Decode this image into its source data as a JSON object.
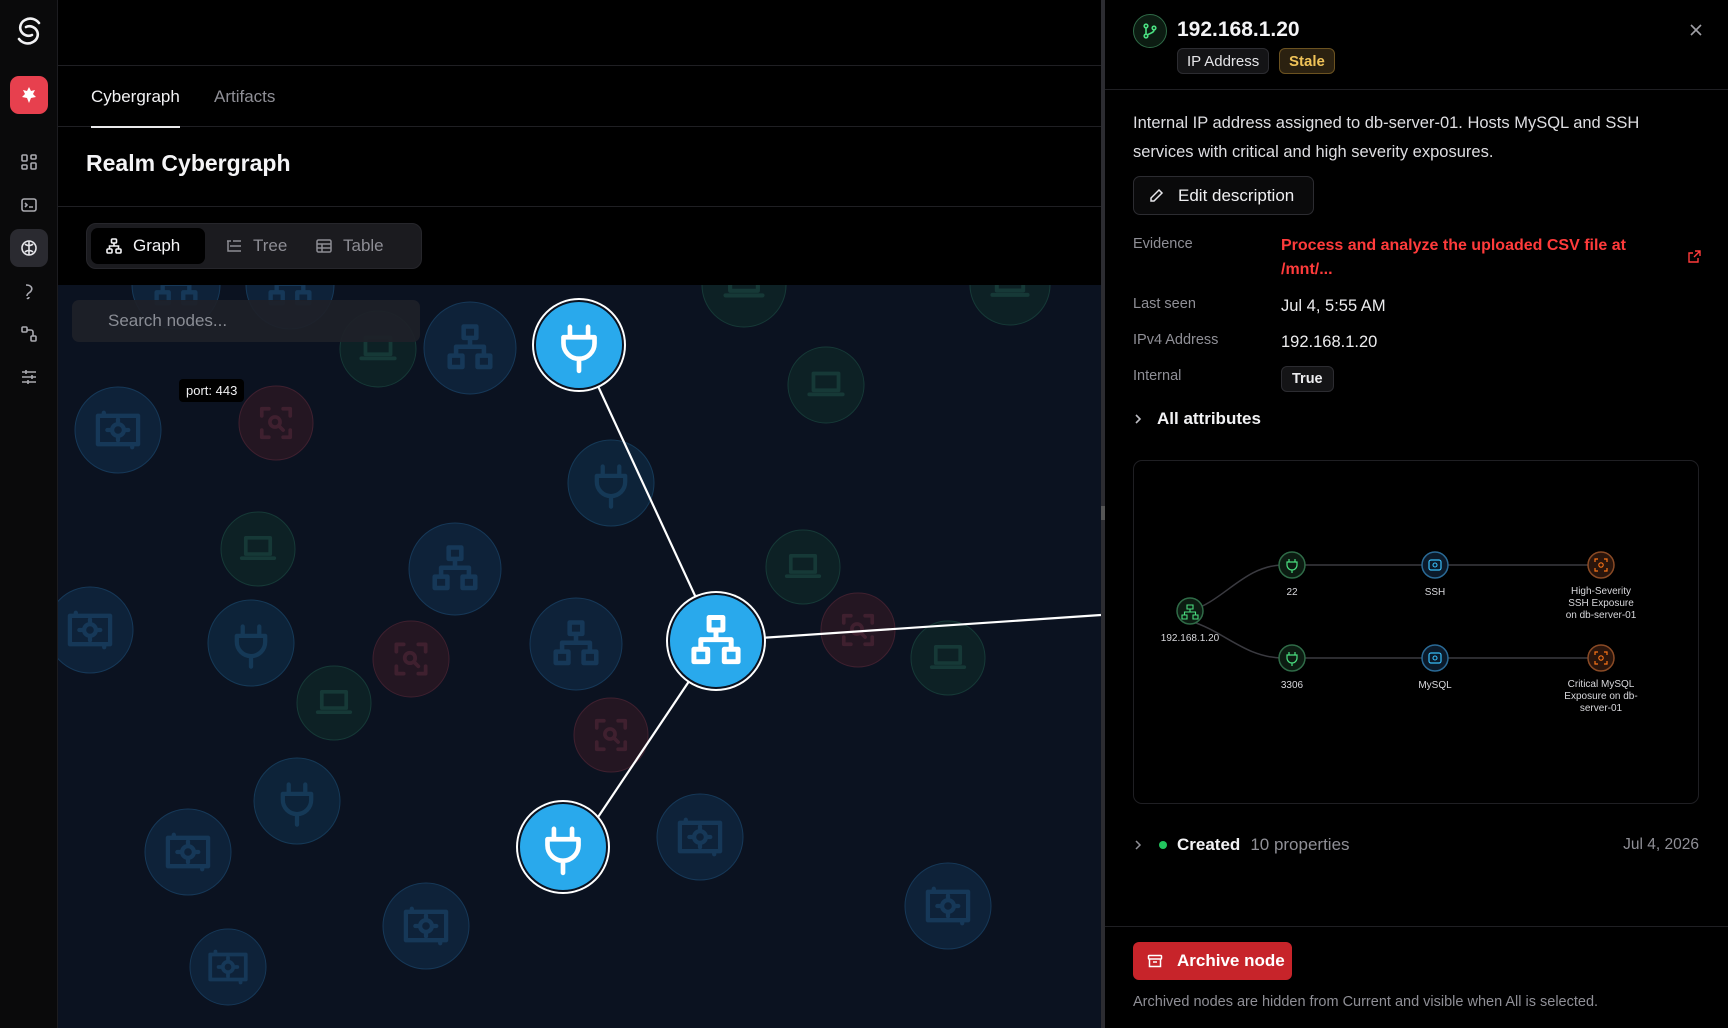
{
  "nav": {
    "tabs": [
      {
        "label": "Cybergraph",
        "active": true
      },
      {
        "label": "Artifacts",
        "active": false
      }
    ]
  },
  "page": {
    "title": "Realm Cybergraph",
    "views": [
      {
        "label": "Graph",
        "icon": "hierarchy-icon",
        "active": true
      },
      {
        "label": "Tree",
        "icon": "tree-list-icon",
        "active": false
      },
      {
        "label": "Table",
        "icon": "table-icon",
        "active": false
      }
    ]
  },
  "graph": {
    "search_placeholder": "Search nodes...",
    "tooltip": "port: 443",
    "colors": {
      "node_active": "#29a9ec",
      "edge": "#ffffff",
      "bg": "#0b1220"
    }
  },
  "panel": {
    "title": "192.168.1.20",
    "type_badge": "IP Address",
    "status_badge": "Stale",
    "description": "Internal IP address assigned to db-server-01. Hosts MySQL and SSH services with critical and high severity exposures.",
    "edit_label": "Edit description",
    "fields": {
      "evidence_key": "Evidence",
      "evidence_val": "Process and analyze the uploaded CSV file at /mnt/...",
      "last_seen_key": "Last seen",
      "last_seen_val": "Jul 4, 5:55 AM",
      "ipv4_key": "IPv4 Address",
      "ipv4_val": "192.168.1.20",
      "internal_key": "Internal",
      "internal_val": "True"
    },
    "all_attributes_label": "All attributes",
    "mini_graph": {
      "root": "192.168.1.20",
      "port_a": "22",
      "svc_a": "SSH",
      "exposure_a": [
        "High-Severity",
        "SSH Exposure",
        "on db-server-01"
      ],
      "port_b": "3306",
      "svc_b": "MySQL",
      "exposure_b": [
        "Critical MySQL",
        "Exposure on db-",
        "server-01"
      ]
    },
    "created": {
      "label": "Created",
      "properties": "10 properties",
      "date": "Jul 4, 2026"
    },
    "archive_label": "Archive node",
    "archive_note": "Archived nodes are hidden from Current and visible when All is selected."
  }
}
